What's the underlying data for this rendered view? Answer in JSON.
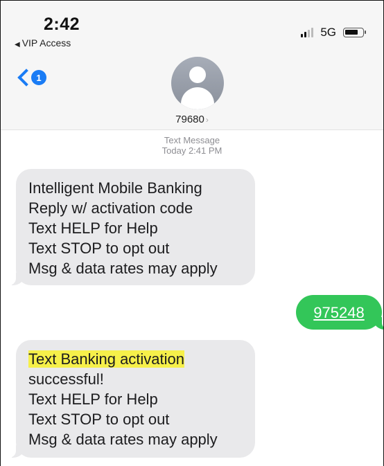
{
  "status_bar": {
    "time": "2:42",
    "back_app_label": "VIP Access",
    "network": "5G"
  },
  "nav": {
    "unread_badge": "1"
  },
  "contact": {
    "number": "79680"
  },
  "thread": {
    "meta_label": "Text Message",
    "meta_time": "Today 2:41 PM"
  },
  "messages": [
    {
      "direction": "incoming",
      "lines": [
        "Intelligent Mobile Banking",
        "Reply w/ activation code",
        "Text HELP for Help",
        "Text STOP to opt out",
        "Msg & data rates may apply"
      ]
    },
    {
      "direction": "outgoing",
      "text": "975248"
    },
    {
      "direction": "incoming",
      "lines": [
        "Text Banking activation",
        "successful!",
        "Text HELP for Help",
        "Text STOP to opt out",
        "Msg & data rates may apply"
      ],
      "highlighted_line": "Text Banking activation"
    }
  ],
  "colors": {
    "accent": "#1a7cf5",
    "outgoing_bubble": "#33c659",
    "incoming_bubble": "#e9e9eb",
    "highlight": "#f6f04a"
  },
  "icons": [
    "back-chevron-icon",
    "signal-bars-icon",
    "battery-icon",
    "contact-avatar-icon",
    "chevron-right-icon"
  ]
}
